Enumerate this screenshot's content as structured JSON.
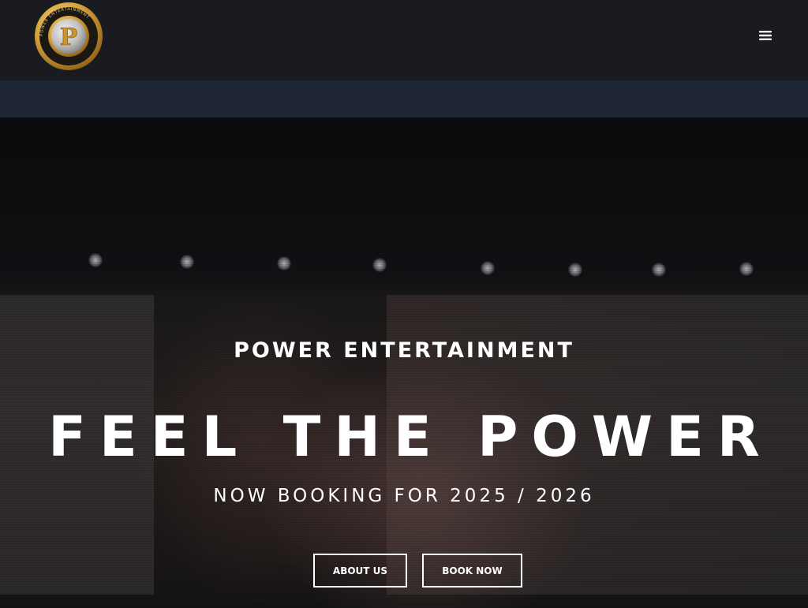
{
  "brand": {
    "name": "Power Entertainment",
    "logo_letter": "P",
    "logo_ring_text": "POWER ENTERTAINMENT",
    "colors": {
      "gold": "#d9a93a",
      "gold_light": "#f3d27a",
      "header_bg": "#1a1b20",
      "subbar_bg": "#1e2533"
    }
  },
  "header": {
    "menu_icon": "hamburger-menu-icon"
  },
  "hero": {
    "eyebrow": "POWER ENTERTAINMENT",
    "headline": "FEEL THE POWER",
    "subline": "NOW BOOKING FOR 2025 / 2026",
    "buttons": {
      "about_label": "ABOUT US",
      "book_label": "BOOK NOW"
    }
  }
}
